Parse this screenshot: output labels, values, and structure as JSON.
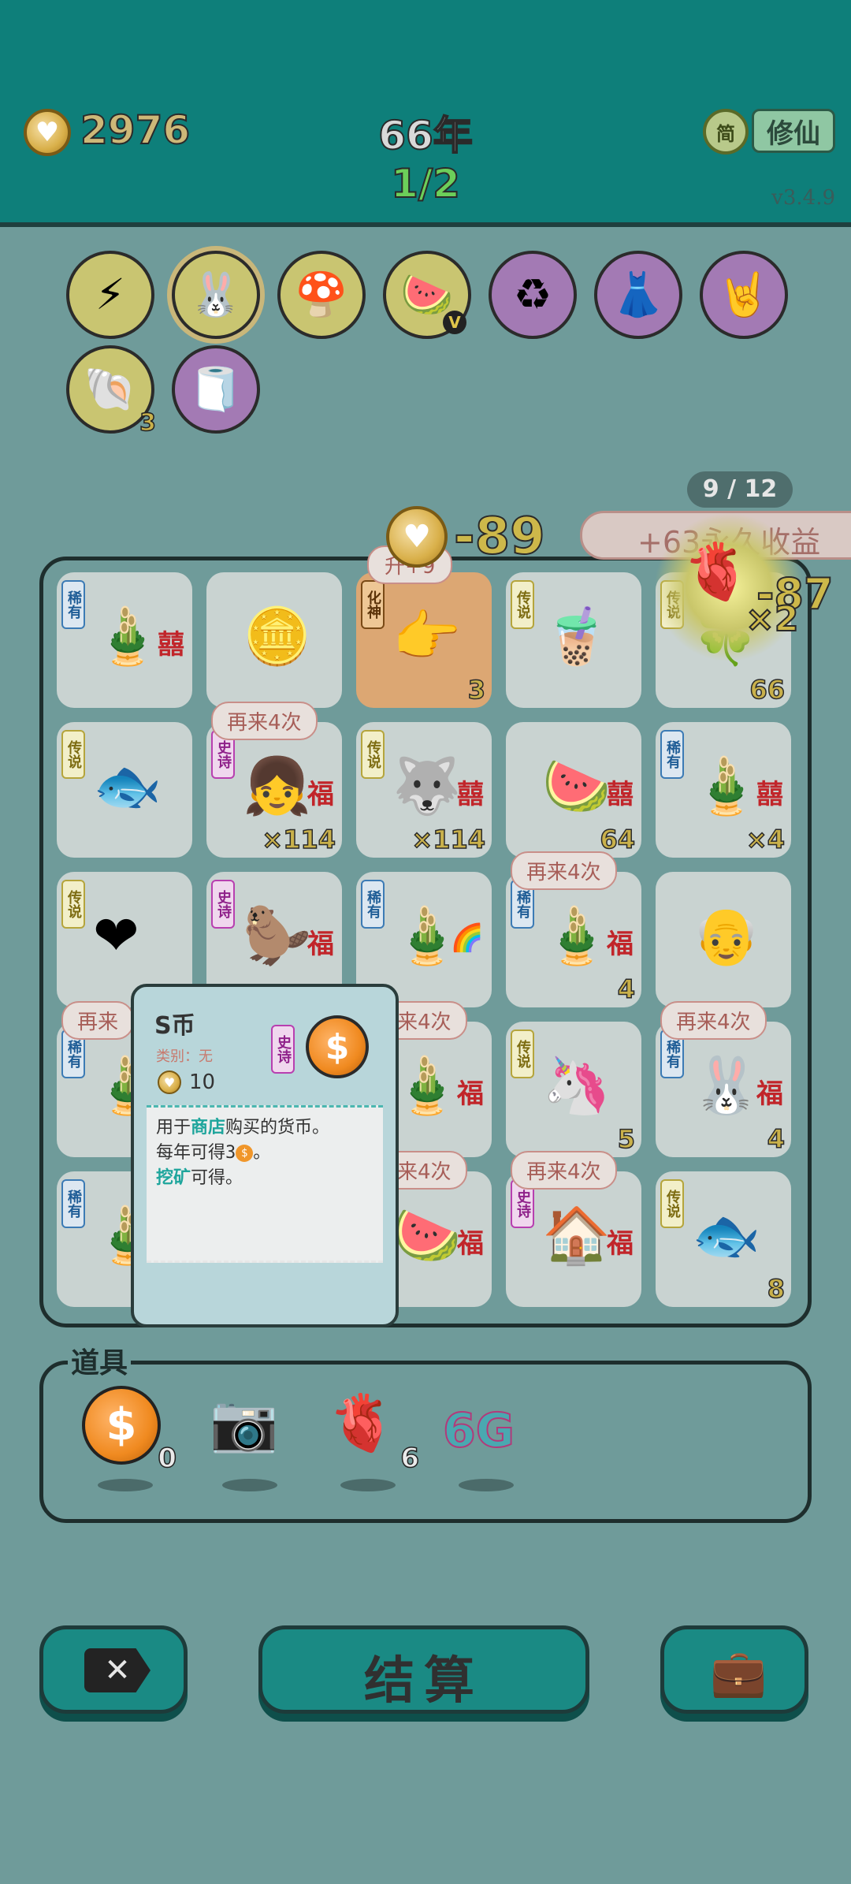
{
  "header": {
    "coins": "2976",
    "year": "66年",
    "stage": "1/2",
    "mode_icon_label": "简",
    "mode_button_label": "修仙",
    "version": "v3.4.9"
  },
  "relic_slots": [
    {
      "icon": "lightning-icon",
      "glyph": "⚡"
    },
    {
      "icon": "bunny-icon",
      "glyph": "🐰"
    },
    {
      "icon": "mushroom-cloud-icon",
      "glyph": "🍄"
    },
    {
      "icon": "fruit-basket-icon",
      "glyph": "🍉",
      "badge": "V"
    },
    {
      "icon": "recycle-icon",
      "glyph": "♻"
    },
    {
      "icon": "skirt-icon",
      "glyph": "👗"
    },
    {
      "icon": "rock-hand-icon",
      "glyph": "🤘"
    },
    {
      "icon": "shell-icon",
      "glyph": "🐚",
      "count": "3"
    },
    {
      "icon": "tissue-box-icon",
      "glyph": "🧻"
    }
  ],
  "board": {
    "slot_counter": "9 / 12",
    "coin_delta": "-89",
    "income_banner": "+63永久收益",
    "liver_delta": "-87",
    "liver_mult": "×2",
    "bubble_plus": "升+9",
    "tiles": [
      {
        "tag": "稀有",
        "tagtype": "rare",
        "icon": "bamboo-xi-icon",
        "glyph": "🎍",
        "extra": "囍"
      },
      {
        "tag": "",
        "tagtype": "",
        "icon": "coins-pile-icon",
        "glyph": "🪙"
      },
      {
        "tag": "化神",
        "tagtype": "hua",
        "icon": "pointing-hand-icon",
        "glyph": "👉",
        "count": "3",
        "orange": true
      },
      {
        "tag": "传说",
        "tagtype": "legend",
        "icon": "bubble-tea-icon",
        "glyph": "🧋"
      },
      {
        "tag": "传说",
        "tagtype": "legend",
        "icon": "clover-field-icon",
        "glyph": "🍀",
        "count": "66"
      },
      {
        "tag": "传说",
        "tagtype": "legend",
        "icon": "koi-fish-icon",
        "glyph": "🐟"
      },
      {
        "tag": "史诗",
        "tagtype": "epic",
        "icon": "girl-portrait-icon",
        "glyph": "👧",
        "extra": "福",
        "count": "×114",
        "bubble": "再来4次"
      },
      {
        "tag": "传说",
        "tagtype": "legend",
        "icon": "husky-king-icon",
        "glyph": "🐺",
        "extra": "囍",
        "count": "×114"
      },
      {
        "tag": "",
        "tagtype": "",
        "icon": "watermelon-xi-icon",
        "glyph": "🍉",
        "extra": "囍",
        "count": "64"
      },
      {
        "tag": "稀有",
        "tagtype": "rare",
        "icon": "bamboo-xi-icon",
        "glyph": "🎍",
        "extra": "囍",
        "count": "×4"
      },
      {
        "tag": "传说",
        "tagtype": "legend",
        "icon": "man-heart-icon",
        "glyph": "❤"
      },
      {
        "tag": "史诗",
        "tagtype": "epic",
        "icon": "marmot-icon",
        "glyph": "🦫",
        "extra": "福"
      },
      {
        "tag": "稀有",
        "tagtype": "rare",
        "icon": "bamboo-rainbow-icon",
        "glyph": "🎍",
        "extra": "🌈"
      },
      {
        "tag": "稀有",
        "tagtype": "rare",
        "icon": "bamboo-fu-icon",
        "glyph": "🎍",
        "extra": "福",
        "count": "4",
        "bubble": "再来4次"
      },
      {
        "tag": "",
        "tagtype": "",
        "icon": "old-man-icon",
        "glyph": "👴"
      },
      {
        "tag": "稀有",
        "tagtype": "rare",
        "icon": "bamboo-icon",
        "glyph": "🎍",
        "bubble": "再来"
      },
      {
        "tag": "",
        "tagtype": "",
        "icon": "hidden-icon",
        "glyph": ""
      },
      {
        "tag": "",
        "tagtype": "",
        "icon": "bamboo-fu-icon",
        "glyph": "🎍",
        "extra": "福",
        "bubble": "再来4次"
      },
      {
        "tag": "传说",
        "tagtype": "legend",
        "icon": "unicorn-icon",
        "glyph": "🦄",
        "count": "5"
      },
      {
        "tag": "稀有",
        "tagtype": "rare",
        "icon": "rabbit-fu-icon",
        "glyph": "🐰",
        "extra": "福",
        "count": "4",
        "bubble": "再来4次"
      },
      {
        "tag": "稀有",
        "tagtype": "rare",
        "icon": "bamboo-icon",
        "glyph": "🎍"
      },
      {
        "tag": "",
        "tagtype": "",
        "icon": "hidden-icon",
        "glyph": ""
      },
      {
        "tag": "",
        "tagtype": "",
        "icon": "watermelon-fu-icon",
        "glyph": "🍉",
        "extra": "福",
        "bubble": "再来4次"
      },
      {
        "tag": "史诗",
        "tagtype": "epic",
        "icon": "rabbit-house-icon",
        "glyph": "🏠",
        "extra": "福",
        "bubble": "再来4次"
      },
      {
        "tag": "传说",
        "tagtype": "legend",
        "icon": "koi-fish-icon",
        "glyph": "🐟",
        "count": "8"
      }
    ]
  },
  "popup": {
    "title": "S币",
    "category": "类别：无",
    "rarity": "史诗",
    "value": "10",
    "desc_line1_a": "用于",
    "desc_line1_b": "商店",
    "desc_line1_c": "购买的货币。",
    "desc_line2_a": "每年可得3",
    "desc_line2_b": "。",
    "desc_line3_a": "挖矿",
    "desc_line3_b": "可得。"
  },
  "tools": {
    "label": "道具",
    "items": [
      {
        "icon": "s-coin-icon",
        "glyph": "$",
        "count": "0"
      },
      {
        "icon": "camera-icon",
        "glyph": "📷",
        "count": ""
      },
      {
        "icon": "liver-icon",
        "glyph": "🫀",
        "count": "6"
      },
      {
        "icon": "6g-icon",
        "glyph": "6G",
        "count": ""
      }
    ]
  },
  "bottom": {
    "settle_label": "结算",
    "cancel_icon": "close-tag-icon",
    "bag_icon": "briefcase-icon"
  },
  "colors": {
    "accent": "#0e7f7a",
    "overlay": "#6f9b9a",
    "gold": "#c9b14b"
  }
}
